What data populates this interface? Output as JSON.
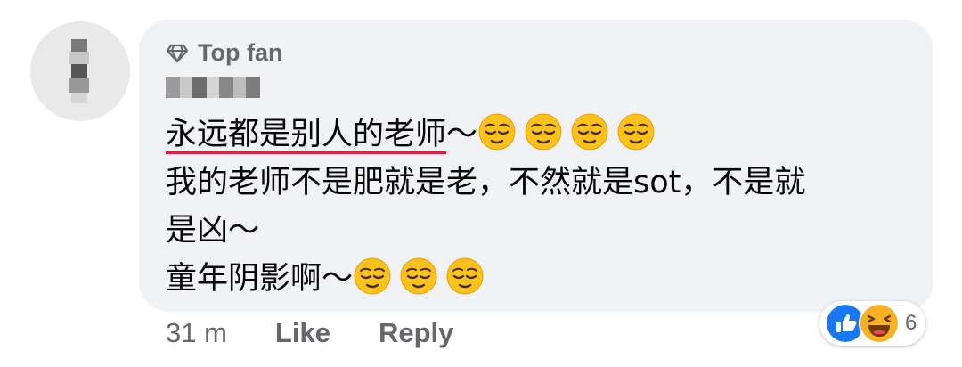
{
  "comment": {
    "badge_label": "Top fan",
    "text_linked": "永远都是别人的老师",
    "text_line1_suffix": "～",
    "text_line2": "我的老师不是肥就是老，不然就是sot，不是就",
    "text_line3": "是凶～",
    "text_line4": "童年阴影啊～",
    "emoji_name": "relieved-face-emoji"
  },
  "actions": {
    "timestamp": "31 m",
    "like_label": "Like",
    "reply_label": "Reply"
  },
  "reactions": {
    "types": [
      "like-reaction",
      "haha-reaction"
    ],
    "count": "6"
  },
  "colors": {
    "bubble": "#f0f2f5",
    "secondary_text": "#65676b",
    "like_blue": "#1877f2",
    "haha_yellow": "#f7b125",
    "link_underline": "#e41e3f"
  }
}
